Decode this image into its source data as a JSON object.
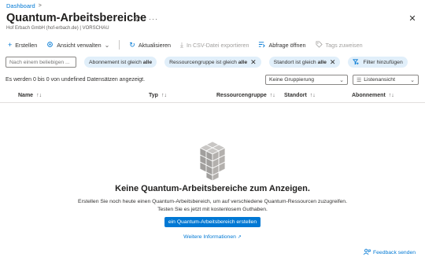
{
  "breadcrumb": {
    "item": "Dashboard",
    "separator": ">"
  },
  "header": {
    "title": "Quantum-Arbeitsbereiche",
    "subtitle": "Hof Erbach GmbH (hof-erbach.de) | VORSCHAU",
    "pin_icon": "pin-icon",
    "more_icon": "more-icon",
    "close_icon": "close-icon"
  },
  "toolbar": {
    "create": "Erstellen",
    "manage_view": "Ansicht verwalten",
    "refresh": "Aktualisieren",
    "export_csv": "In CSV-Datei exportieren",
    "open_query": "Abfrage öffnen",
    "assign_tags": "Tags zuweisen"
  },
  "filters": {
    "search_placeholder": "Nach einem beliebigen ...",
    "pills": [
      {
        "label": "Abonnement ist gleich ",
        "value": "alle"
      },
      {
        "label": "Ressourcengruppe ist gleich ",
        "value": "alle"
      },
      {
        "label": "Standort ist gleich ",
        "value": "alle"
      }
    ],
    "add_filter": "Filter hinzufügen"
  },
  "records": {
    "count_text": "Es werden 0 bis 0 von undefined Datensätzen angezeigt.",
    "grouping": "Keine Gruppierung",
    "view": "Listenansicht"
  },
  "table": {
    "columns": [
      "Name",
      "Typ",
      "Ressourcengruppe",
      "Standort",
      "Abonnement"
    ]
  },
  "empty_state": {
    "title": "Keine Quantum-Arbeitsbereiche zum Anzeigen.",
    "description_line1": "Erstellen Sie noch heute einen Quantum-Arbeitsbereich, um auf verschiedene Quantum-Ressourcen zuzugreifen.",
    "description_line2": "Testen Sie es jetzt mit kostenlosem Guthaben.",
    "create_button": "ein Quantum-Arbeitsbereich erstellen",
    "more_info": "Weitere Informationen"
  },
  "feedback": "Feedback senden",
  "colors": {
    "accent": "#0078d4",
    "pill_bg": "#e1effa",
    "text": "#323130"
  }
}
